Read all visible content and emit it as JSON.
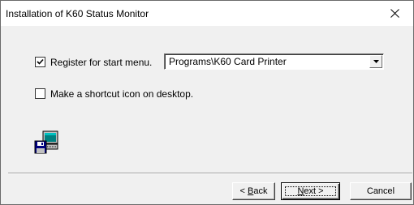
{
  "window": {
    "title": "Installation of K60 Status Monitor",
    "close_symbol": "×"
  },
  "options": {
    "start_menu": {
      "checked": true,
      "label": "Register for start menu."
    },
    "program_folder": {
      "value": "Programs\\K60 Card Printer"
    },
    "desktop_shortcut": {
      "checked": false,
      "label": "Make a shortcut icon on desktop."
    }
  },
  "icons": {
    "checkmark": "checkmark-icon",
    "dropdown": "dropdown-arrow-icon",
    "installer": "floppy-computer-icon",
    "close": "close-icon"
  },
  "buttons": {
    "back": {
      "prefix": "< ",
      "mnemonic": "B",
      "rest": "ack"
    },
    "next": {
      "mnemonic": "N",
      "rest": "ext >"
    },
    "cancel": "Cancel"
  }
}
